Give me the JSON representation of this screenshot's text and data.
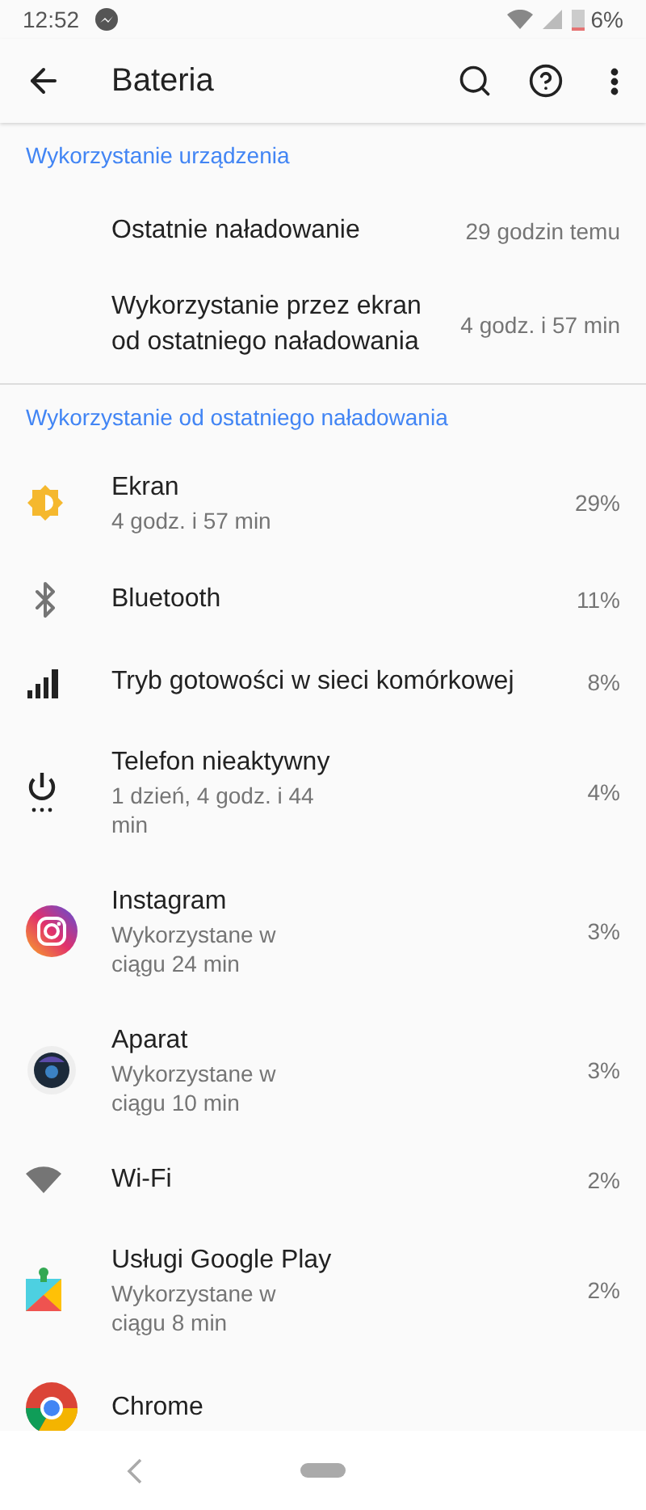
{
  "status_bar": {
    "time": "12:52",
    "battery": "6%"
  },
  "toolbar": {
    "title": "Bateria"
  },
  "sections": [
    {
      "header": "Wykorzystanie urządzenia",
      "items": [
        {
          "title": "Ostatnie naładowanie",
          "value": "29 godzin temu"
        },
        {
          "title": "Wykorzystanie przez ekran od ostatniego naładowania",
          "value": "4 godz. i 57 min"
        }
      ]
    },
    {
      "header": "Wykorzystanie od ostatniego naładowania",
      "items": [
        {
          "kind": "screen",
          "title": "Ekran",
          "subtitle": "4 godz. i 57 min",
          "value": "29%"
        },
        {
          "kind": "bluetooth",
          "title": "Bluetooth",
          "value": "11%"
        },
        {
          "kind": "cell",
          "title": "Tryb gotowości w sieci komórkowej",
          "value": "8%"
        },
        {
          "kind": "idle",
          "title": "Telefon nieaktywny",
          "subtitle": "1 dzień, 4 godz. i 44 min",
          "value": "4%"
        },
        {
          "kind": "instagram",
          "title": "Instagram",
          "subtitle": "Wykorzystane w ciągu 24 min",
          "value": "3%"
        },
        {
          "kind": "camera",
          "title": "Aparat",
          "subtitle": "Wykorzystane w ciągu 10 min",
          "value": "3%"
        },
        {
          "kind": "wifi",
          "title": "Wi-Fi",
          "value": "2%"
        },
        {
          "kind": "play",
          "title": "Usługi Google Play",
          "subtitle": "Wykorzystane w ciągu 8 min",
          "value": "2%"
        },
        {
          "kind": "chrome",
          "title": "Chrome"
        }
      ]
    }
  ]
}
